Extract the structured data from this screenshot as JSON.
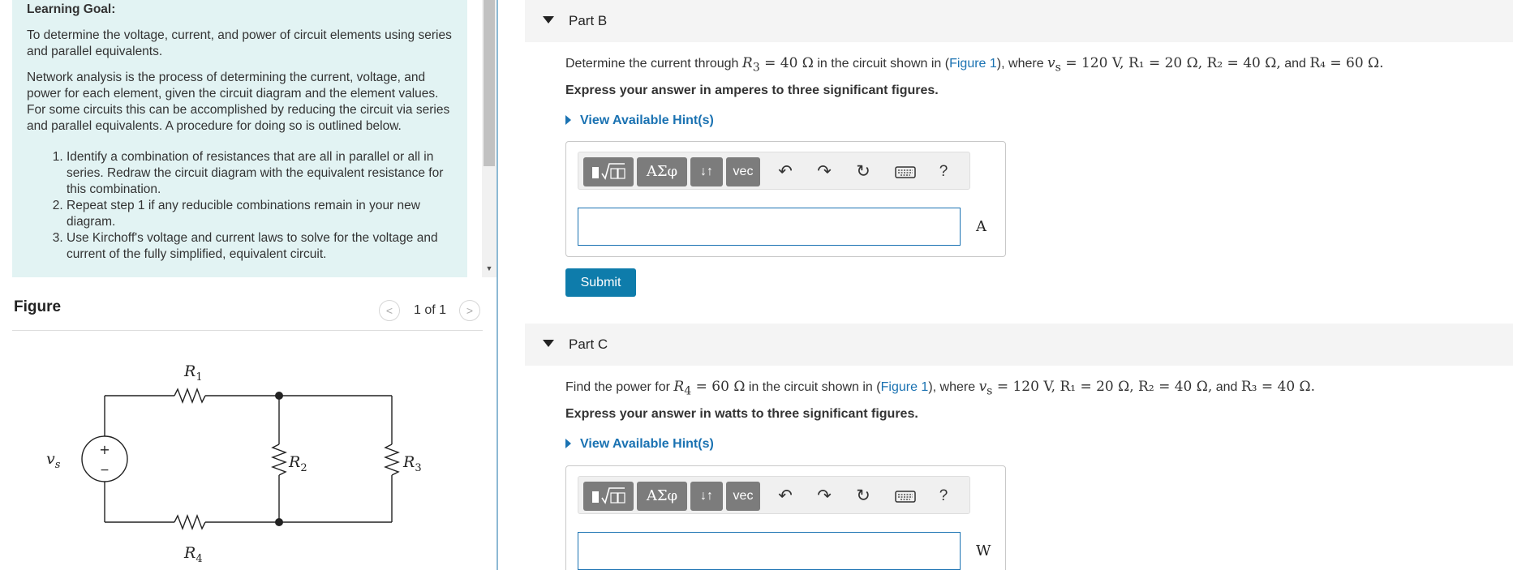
{
  "learning_goal": {
    "heading": "Learning Goal:",
    "paragraph1": "To determine the voltage, current, and power of circuit elements using series and parallel equivalents.",
    "paragraph2": "Network analysis is the process of determining the current, voltage, and power for each element, given the circuit diagram and the element values. For some circuits this can be accomplished by reducing the circuit via series and parallel equivalents. A procedure for doing so is outlined below.",
    "steps": [
      "Identify a combination of resistances that are all in parallel or all in series. Redraw the circuit diagram with the equivalent resistance for this combination.",
      "Repeat step 1 if any reducible combinations remain in your new diagram.",
      "Use Kirchoff's voltage and current laws to solve for the voltage and current of the fully simplified, equivalent circuit."
    ]
  },
  "figure": {
    "title": "Figure",
    "pager": "1 of 1",
    "prev_icon": "chevron-left-icon",
    "next_icon": "chevron-right-icon",
    "labels": {
      "r1": "R",
      "r1_sub": "1",
      "r2": "R",
      "r2_sub": "2",
      "r3": "R",
      "r3_sub": "3",
      "r4": "R",
      "r4_sub": "4",
      "vs": "v",
      "vs_sub": "s",
      "plus": "+",
      "minus": "−"
    }
  },
  "part_b": {
    "title": "Part B",
    "q_pre": "Determine the current through ",
    "q_r3": "R",
    "q_r3_sub": "3",
    "q_r3_val": " = 40 Ω",
    "q_mid": " in the circuit shown in (",
    "q_fig": "Figure 1",
    "q_where": "), where ",
    "q_vals": "v",
    "q_vals_sub": "s",
    "q_rest": " = 120 V, R₁ = 20 Ω, R₂ = 40 Ω,",
    "q_and": " and ",
    "q_last": "R₄ = 60 Ω.",
    "instruction": "Express your answer in amperes to three significant figures.",
    "hint": "View Available Hint(s)",
    "unit": "A",
    "submit": "Submit"
  },
  "part_c": {
    "title": "Part C",
    "q_pre": "Find the power for ",
    "q_r4": "R",
    "q_r4_sub": "4",
    "q_r4_val": " = 60 Ω",
    "q_mid": " in the circuit shown in (",
    "q_fig": "Figure 1",
    "q_where": "), where ",
    "q_vals": "v",
    "q_vals_sub": "s",
    "q_rest": " = 120 V, R₁ = 20 Ω, R₂ = 40 Ω,",
    "q_and": " and ",
    "q_last": "R₃ = 40 Ω.",
    "instruction": "Express your answer in watts to three significant figures.",
    "hint": "View Available Hint(s)",
    "unit": "W"
  },
  "toolbar": {
    "templates_icon": "templates-icon",
    "symbols": "ΑΣφ",
    "updown": "↓↑",
    "vec": "vec",
    "undo_icon": "undo-icon",
    "redo_icon": "redo-icon",
    "reset_icon": "reset-icon",
    "keyboard_icon": "keyboard-icon",
    "help": "?"
  },
  "colors": {
    "goal_bg": "#e2f3f3",
    "link": "#1a72b2",
    "submit_bg": "#0e7cab",
    "toolbar_btn": "#7c7c7c"
  }
}
